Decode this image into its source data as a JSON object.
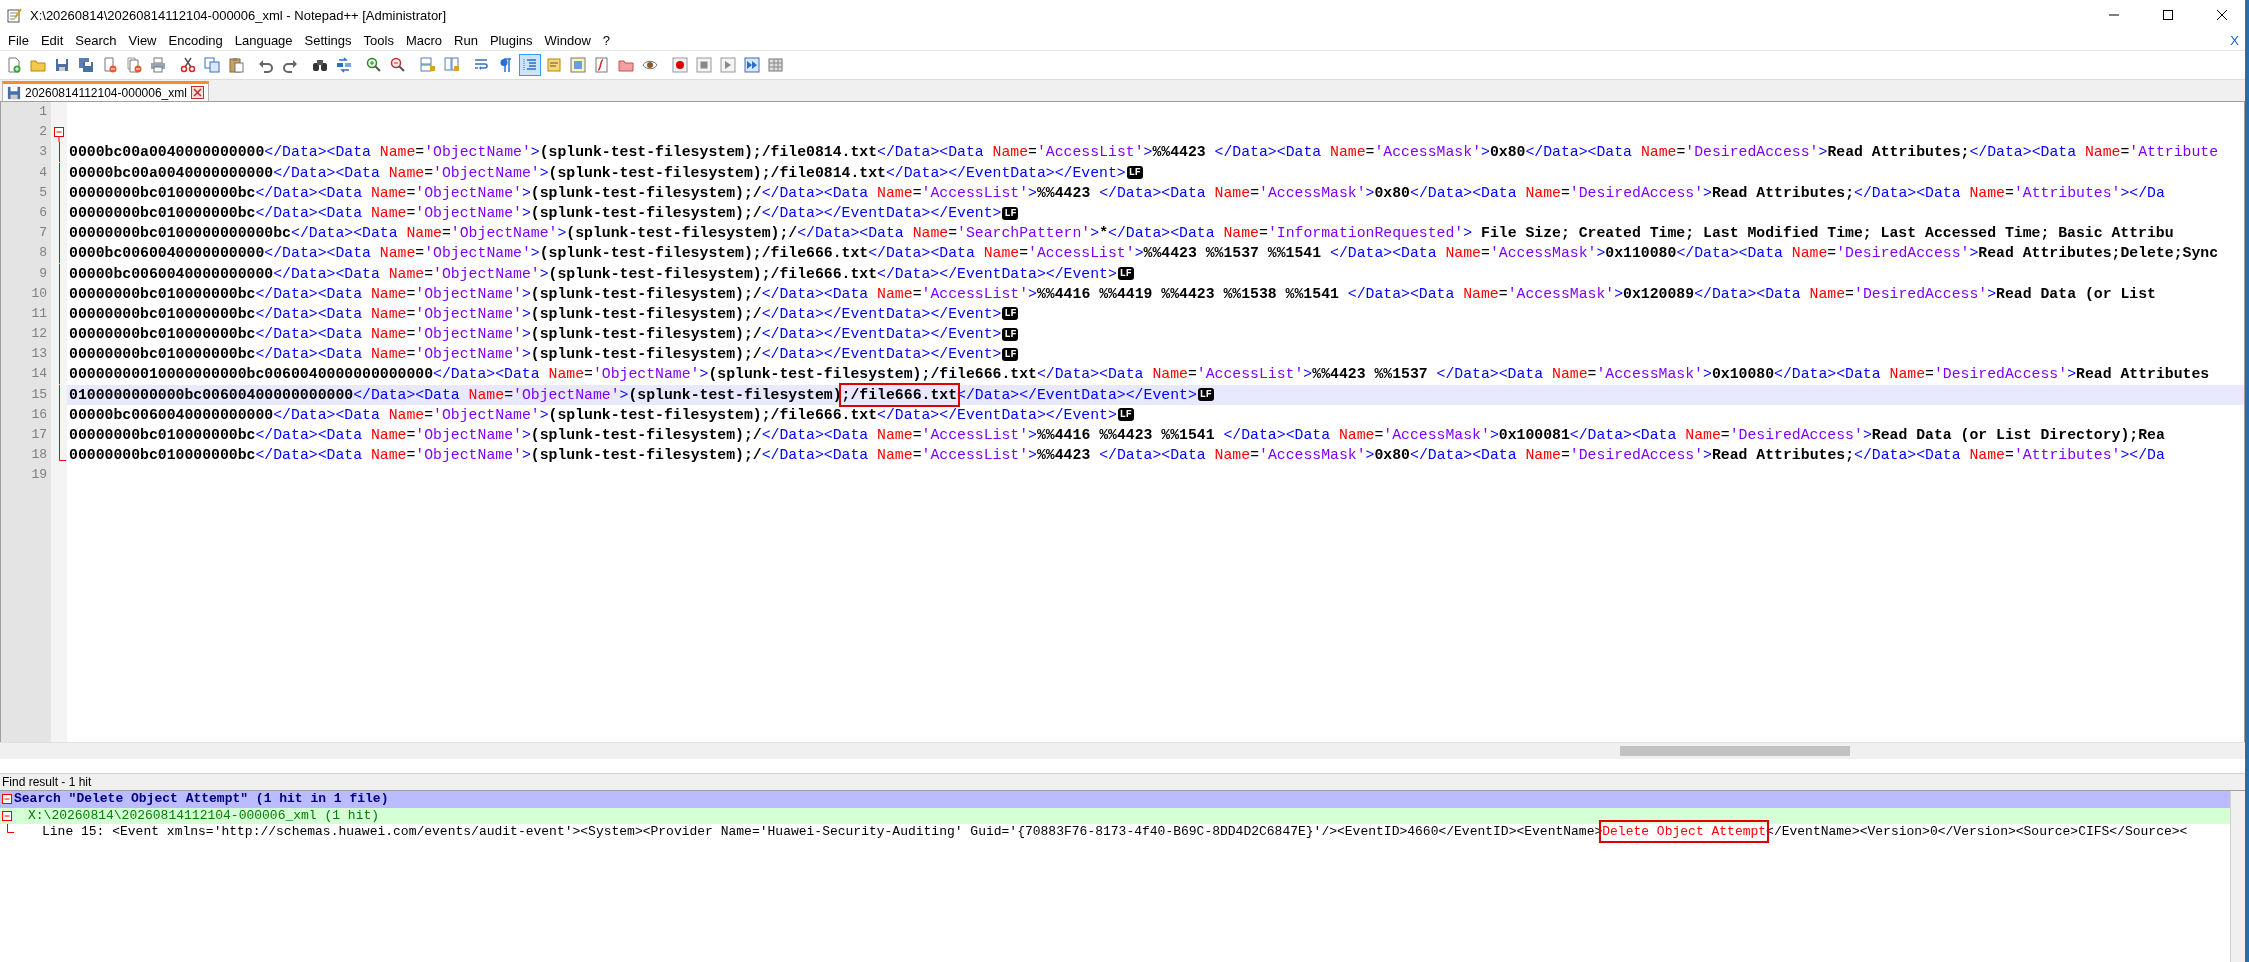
{
  "window": {
    "title": "X:\\20260814\\20260814112104-000006_xml - Notepad++ [Administrator]"
  },
  "menu": [
    "File",
    "Edit",
    "Search",
    "View",
    "Encoding",
    "Language",
    "Settings",
    "Tools",
    "Macro",
    "Run",
    "Plugins",
    "Window",
    "?"
  ],
  "menu_close": "X",
  "toolbar": [
    {
      "kind": "new",
      "pressed": false
    },
    {
      "kind": "open",
      "pressed": false
    },
    {
      "kind": "save",
      "pressed": false
    },
    {
      "kind": "saveall",
      "pressed": false
    },
    {
      "kind": "close",
      "pressed": false
    },
    {
      "kind": "closeall",
      "pressed": false
    },
    {
      "kind": "print",
      "pressed": false
    },
    {
      "kind": "cut",
      "pressed": false
    },
    {
      "kind": "copy",
      "pressed": false
    },
    {
      "kind": "paste",
      "pressed": false
    },
    {
      "kind": "undo",
      "pressed": false
    },
    {
      "kind": "redo",
      "pressed": false
    },
    {
      "kind": "find",
      "pressed": false
    },
    {
      "kind": "replace",
      "pressed": false
    },
    {
      "kind": "zoomin",
      "pressed": false
    },
    {
      "kind": "zoomout",
      "pressed": false
    },
    {
      "kind": "syncv",
      "pressed": false
    },
    {
      "kind": "synch",
      "pressed": false
    },
    {
      "kind": "wrap",
      "pressed": false
    },
    {
      "kind": "showall",
      "pressed": false
    },
    {
      "kind": "indent",
      "pressed": true
    },
    {
      "kind": "udl",
      "pressed": false
    },
    {
      "kind": "docmap",
      "pressed": false
    },
    {
      "kind": "funclist",
      "pressed": false
    },
    {
      "kind": "folder",
      "pressed": false
    },
    {
      "kind": "monitor",
      "pressed": false
    },
    {
      "kind": "record",
      "pressed": false
    },
    {
      "kind": "stop",
      "pressed": false
    },
    {
      "kind": "play",
      "pressed": false
    },
    {
      "kind": "playmulti",
      "pressed": false
    },
    {
      "kind": "savemacro",
      "pressed": false
    }
  ],
  "tabs": [
    {
      "label": "20260814112104-000006_xml",
      "selected": true
    }
  ],
  "editor": {
    "lines": [
      {
        "number": "1",
        "current": false,
        "fold_start": false,
        "in_fold": false,
        "fold_end": false
      },
      {
        "number": "2",
        "current": false,
        "fold_start": true,
        "in_fold": false,
        "fold_end": false
      },
      {
        "number": "3",
        "current": false,
        "fold_start": false,
        "in_fold": true,
        "fold_end": false,
        "parts": [
          {
            "text": "0000bc00a0040000000000</Data><Data Name='ObjectName'>(splunk-test-filesystem);/file0814.txt</Data><Data Name='AccessList'>%%4423 </Data><Data Name='AccessMask'>0x80</Data><Data Name='DesiredAccess'>Read Attributes;</Data><Data Name='Attribute"
          }
        ]
      },
      {
        "number": "4",
        "current": false,
        "fold_start": false,
        "in_fold": true,
        "fold_end": false,
        "parts": [
          {
            "text": "00000bc00a0040000000000</Data><Data Name='ObjectName'>(splunk-test-filesystem);/file0814.txt</Data></EventData></Event>"
          }
        ],
        "eol": "LF"
      },
      {
        "number": "5",
        "current": false,
        "fold_start": false,
        "in_fold": true,
        "fold_end": false,
        "parts": [
          {
            "text": "00000000bc010000000bc</Data><Data Name='ObjectName'>(splunk-test-filesystem);/</Data><Data Name='AccessList'>%%4423 </Data><Data Name='AccessMask'>0x80</Data><Data Name='DesiredAccess'>Read Attributes;</Data><Data Name='Attributes'></Da"
          }
        ]
      },
      {
        "number": "6",
        "current": false,
        "fold_start": false,
        "in_fold": true,
        "fold_end": false,
        "parts": [
          {
            "text": "00000000bc010000000bc</Data><Data Name='ObjectName'>(splunk-test-filesystem);/</Data></EventData></Event>"
          }
        ],
        "eol": "LF"
      },
      {
        "number": "7",
        "current": false,
        "fold_start": false,
        "in_fold": true,
        "fold_end": false,
        "parts": [
          {
            "text": "00000000bc0100000000000bc</Data><Data Name='ObjectName'>(splunk-test-filesystem);/</Data><Data Name='SearchPattern'>*</Data><Data Name='InformationRequested'> File Size; Created Time; Last Modified Time; Last Accessed Time; Basic Attribu"
          }
        ]
      },
      {
        "number": "8",
        "current": false,
        "fold_start": false,
        "in_fold": true,
        "fold_end": false,
        "parts": [
          {
            "text": "0000bc0060040000000000</Data><Data Name='ObjectName'>(splunk-test-filesystem);/file666.txt</Data><Data Name='AccessList'>%%4423 %%1537 %%1541 </Data><Data Name='AccessMask'>0x110080</Data><Data Name='DesiredAccess'>Read Attributes;Delete;Sync"
          }
        ]
      },
      {
        "number": "9",
        "current": false,
        "fold_start": false,
        "in_fold": true,
        "fold_end": false,
        "parts": [
          {
            "text": "00000bc0060040000000000</Data><Data Name='ObjectName'>(splunk-test-filesystem);/file666.txt</Data></EventData></Event>"
          }
        ],
        "eol": "LF"
      },
      {
        "number": "10",
        "current": false,
        "fold_start": false,
        "in_fold": true,
        "fold_end": false,
        "parts": [
          {
            "text": "00000000bc010000000bc</Data><Data Name='ObjectName'>(splunk-test-filesystem);/</Data><Data Name='AccessList'>%%4416 %%4419 %%4423 %%1538 %%1541 </Data><Data Name='AccessMask'>0x120089</Data><Data Name='DesiredAccess'>Read Data (or List"
          }
        ]
      },
      {
        "number": "11",
        "current": false,
        "fold_start": false,
        "in_fold": true,
        "fold_end": false,
        "parts": [
          {
            "text": "00000000bc010000000bc</Data><Data Name='ObjectName'>(splunk-test-filesystem);/</Data></EventData></Event>"
          }
        ],
        "eol": "LF"
      },
      {
        "number": "12",
        "current": false,
        "fold_start": false,
        "in_fold": true,
        "fold_end": false,
        "parts": [
          {
            "text": "00000000bc010000000bc</Data><Data Name='ObjectName'>(splunk-test-filesystem);/</Data></EventData></Event>"
          }
        ],
        "eol": "LF"
      },
      {
        "number": "13",
        "current": false,
        "fold_start": false,
        "in_fold": true,
        "fold_end": false,
        "parts": [
          {
            "text": "00000000bc010000000bc</Data><Data Name='ObjectName'>(splunk-test-filesystem);/</Data></EventData></Event>"
          }
        ],
        "eol": "LF"
      },
      {
        "number": "14",
        "current": false,
        "fold_start": false,
        "in_fold": true,
        "fold_end": false,
        "parts": [
          {
            "text": "00000000010000000000bc0060040000000000000</Data><Data Name='ObjectName'>(splunk-test-filesystem);/file666.txt</Data><Data Name='AccessList'>%%4423 %%1537 </Data><Data Name='AccessMask'>0x10080</Data><Data Name='DesiredAccess'>Read Attributes"
          }
        ]
      },
      {
        "number": "15",
        "current": true,
        "fold_start": false,
        "in_fold": true,
        "fold_end": false,
        "parts": [
          {
            "text": "0100000000000bc00600400000000000</Data><Data Name='ObjectName'>(splunk-test-filesystem)"
          },
          {
            "text": ";/file666.txt",
            "boxed": true
          },
          {
            "text": "</Data></EventData></Event>"
          }
        ],
        "eol": "LF"
      },
      {
        "number": "16",
        "current": false,
        "fold_start": false,
        "in_fold": true,
        "fold_end": false,
        "parts": [
          {
            "text": "00000bc0060040000000000</Data><Data Name='ObjectName'>(splunk-test-filesystem);/file666.txt</Data></EventData></Event>"
          }
        ],
        "eol": "LF"
      },
      {
        "number": "17",
        "current": false,
        "fold_start": false,
        "in_fold": true,
        "fold_end": false,
        "parts": [
          {
            "text": "00000000bc010000000bc</Data><Data Name='ObjectName'>(splunk-test-filesystem);/</Data><Data Name='AccessList'>%%4416 %%4423 %%1541 </Data><Data Name='AccessMask'>0x100081</Data><Data Name='DesiredAccess'>Read Data (or List Directory);Rea"
          }
        ]
      },
      {
        "number": "18",
        "current": false,
        "fold_start": false,
        "in_fold": true,
        "fold_end": true,
        "parts": [
          {
            "text": "00000000bc010000000bc</Data><Data Name='ObjectName'>(splunk-test-filesystem);/</Data><Data Name='AccessList'>%%4423 </Data><Data Name='AccessMask'>0x80</Data><Data Name='DesiredAccess'>Read Attributes;</Data><Data Name='Attributes'></Da"
          }
        ]
      },
      {
        "number": "19",
        "current": false,
        "fold_start": false,
        "in_fold": false,
        "fold_end": false
      }
    ]
  },
  "find_panel": {
    "title": "Find result - 1 hit",
    "search": {
      "text": "Search \"Delete Object Attempt\" (1 hit in 1 file)",
      "expanded": true
    },
    "file": {
      "text": "X:\\20260814\\20260814112104-000006_xml (1 hit)",
      "expanded": true
    },
    "results": [
      {
        "label": "Line 15:",
        "parts": [
          {
            "text": "<Event xmlns='http://schemas.huawei.com/events/audit-event'><System><Provider Name='Huawei-Security-Auditing' Guid='{70883F76-8173-4f40-B69C-8DD4D2C6847E}'/><EventID>4660</EventID><EventName>"
          },
          {
            "text": "Delete Object Attempt",
            "kind": "match",
            "boxed": true
          },
          {
            "text": "</EventName><Version>0</Version><Source>CIFS</Source><"
          }
        ]
      }
    ]
  }
}
